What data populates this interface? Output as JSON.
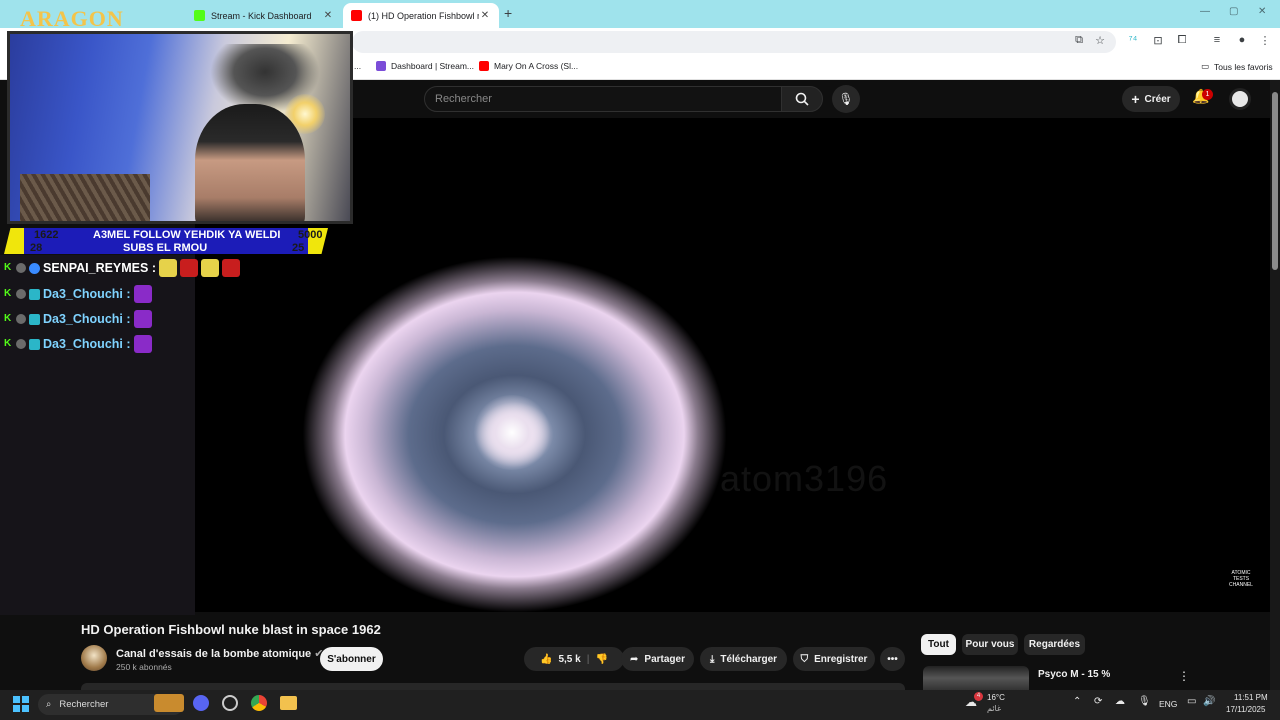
{
  "browser": {
    "tabs": [
      {
        "title": "Stream - Kick Dashboard",
        "active": false
      },
      {
        "title": "(1) HD Operation Fishbowl nuke",
        "active": true
      }
    ],
    "new_tab": "+",
    "bookmarks": [
      {
        "label": "..."
      },
      {
        "label": "Dashboard | Stream..."
      },
      {
        "label": "Mary On A Cross (Sl..."
      }
    ],
    "all_bookmarks": "Tous les favoris"
  },
  "youtube": {
    "search_placeholder": "Rechercher",
    "create_label": "Créer",
    "notification_count": "1",
    "video": {
      "watermark": "atom3196",
      "logo_text": "ATOMIC TESTS CHANNEL"
    },
    "title": "HD Operation Fishbowl nuke blast in space 1962",
    "channel": {
      "name": "Canal d'essais de la bombe atomique",
      "subs": "250 k abonnés",
      "subscribe_label": "S'abonner"
    },
    "actions": {
      "likes": "5,5 k",
      "share": "Partager",
      "download": "Télécharger",
      "save": "Enregistrer",
      "more": "•••"
    },
    "chips": [
      "Tout",
      "Pour vous",
      "Regardées"
    ],
    "recommended": {
      "title": "Psyco M - 15 %"
    }
  },
  "overlay": {
    "logo": "ARAGON",
    "banner": {
      "left_top": "1622",
      "left_bottom": "28",
      "center_top": "A3MEL FOLLOW YEHDIK YA WELDI",
      "center_bottom": "SUBS EL RMOU",
      "right_top": "5000",
      "right_bottom": "25"
    },
    "chat": [
      {
        "user": "SENPAI_REYMES :",
        "color": "white"
      },
      {
        "user": "Da3_Chouchi :",
        "color": "cyan"
      },
      {
        "user": "Da3_Chouchi :",
        "color": "cyan"
      },
      {
        "user": "Da3_Chouchi :",
        "color": "cyan"
      }
    ]
  },
  "taskbar": {
    "search": "Rechercher",
    "weather_temp": "16°C",
    "weather_desc": "غائم",
    "weather_badge": "4",
    "lang": "ENG",
    "time": "11:51 PM",
    "date": "17/11/2025"
  },
  "colors": {
    "tabbar": "#9fe3ec",
    "yt_bg": "#0f0f0f",
    "banner_yellow": "#f0e60c",
    "banner_blue": "#1c1cb8",
    "kick_green": "#53fc18",
    "accent": "#4cc2ff"
  }
}
